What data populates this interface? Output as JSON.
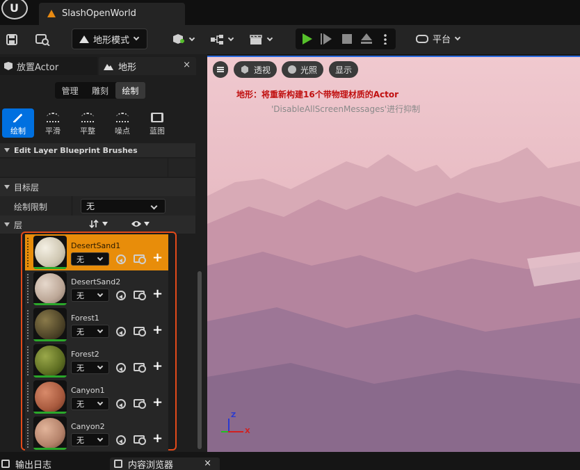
{
  "window": {
    "doc_tab_label": "SlashOpenWorld"
  },
  "toolbar": {
    "mode_label": "地形模式",
    "platform_label": "平台"
  },
  "left_panel": {
    "tabs": [
      {
        "label": "放置Actor"
      },
      {
        "label": "地形"
      }
    ],
    "close": "×",
    "segments": [
      {
        "label": "管理"
      },
      {
        "label": "雕刻"
      },
      {
        "label": "绘制"
      }
    ],
    "tools": [
      {
        "label": "绘制",
        "icon": "brush-icon"
      },
      {
        "label": "平滑",
        "icon": "smooth-icon"
      },
      {
        "label": "平整",
        "icon": "flatten-icon"
      },
      {
        "label": "噪点",
        "icon": "noise-icon"
      },
      {
        "label": "蓝图",
        "icon": "blueprint-icon"
      }
    ],
    "edit_layer_header": "Edit Layer Blueprint Brushes",
    "target_section": "目标层",
    "paint_limit_label": "绘制限制",
    "paint_limit_value": "无",
    "layers_section": "层",
    "layers": [
      {
        "name": "DesertSand1",
        "value": "无",
        "selected": true
      },
      {
        "name": "DesertSand2",
        "value": "无",
        "selected": false
      },
      {
        "name": "Forest1",
        "value": "无",
        "selected": false
      },
      {
        "name": "Forest2",
        "value": "无",
        "selected": false
      },
      {
        "name": "Canyon1",
        "value": "无",
        "selected": false
      },
      {
        "name": "Canyon2",
        "value": "无",
        "selected": false
      }
    ]
  },
  "viewport": {
    "btn_perspective": "透视",
    "btn_lit": "光照",
    "btn_show": "显示",
    "message_red": "地形：将重新构建16个带物理材质的Actor",
    "message_gray": "'DisableAllScreenMessages'进行抑制",
    "axis_z": "Z",
    "axis_x": "X"
  },
  "bottom": {
    "output_log": "输出日志",
    "content_browser": "内容浏览器",
    "close": "×"
  },
  "colors": {
    "accent_orange": "#e88d0a",
    "highlight_red": "#e34a1a",
    "active_blue": "#0070e0",
    "play_green": "#56c02b"
  }
}
